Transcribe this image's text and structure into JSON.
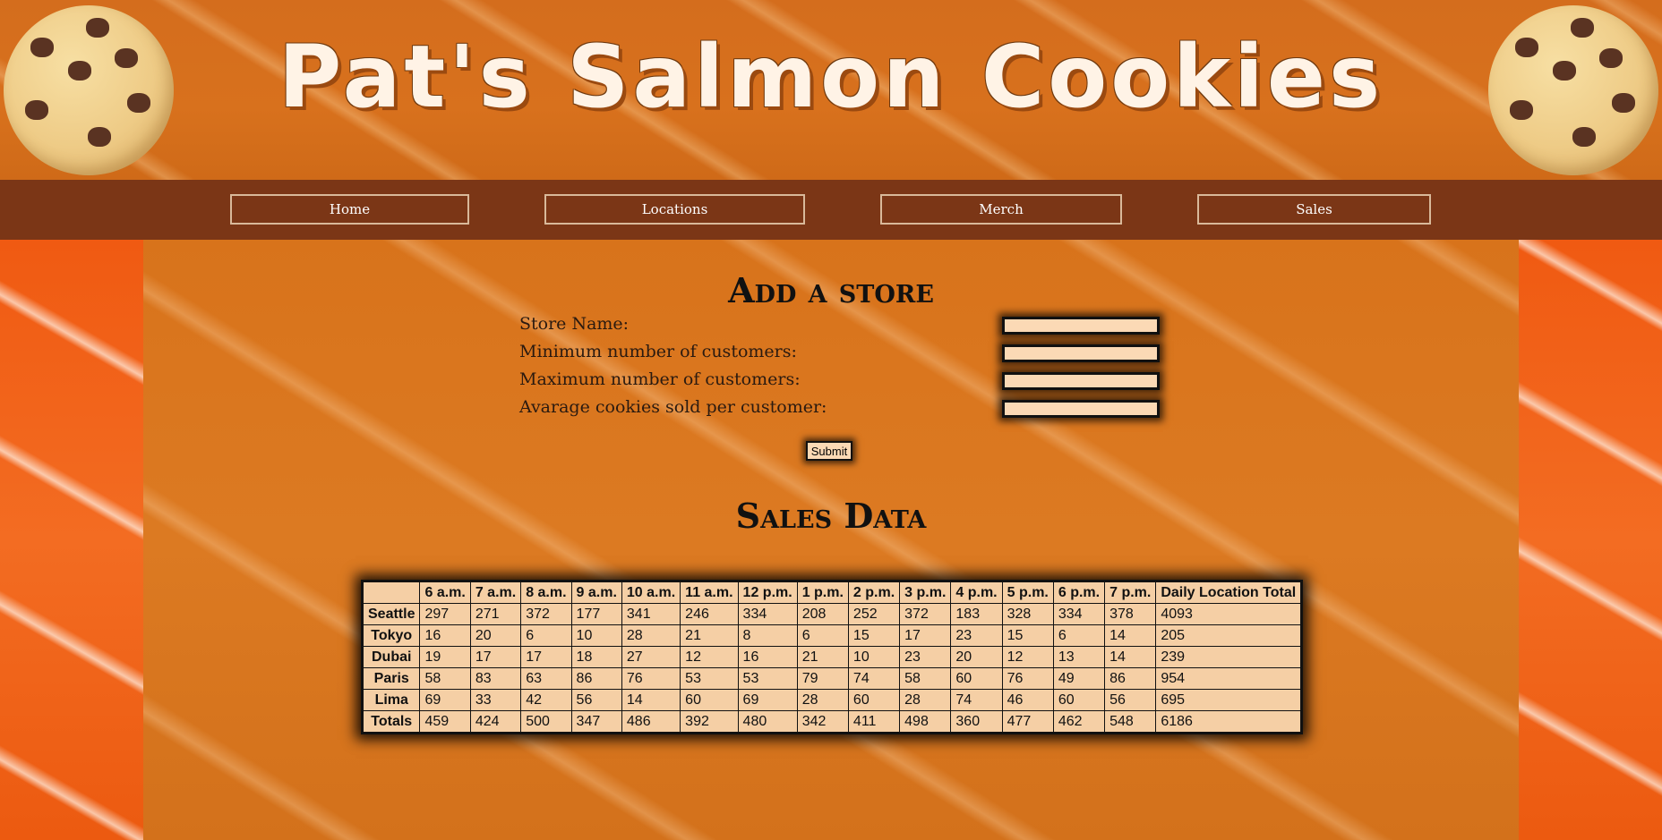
{
  "site": {
    "title": "Pat's Salmon Cookies"
  },
  "icons": {
    "left_cookie": "cookie-icon",
    "right_cookie": "cookie-icon"
  },
  "nav": {
    "items": [
      {
        "label": "Home"
      },
      {
        "label": "Locations"
      },
      {
        "label": "Merch"
      },
      {
        "label": "Sales"
      }
    ]
  },
  "form": {
    "heading": "Add a store",
    "fields": [
      {
        "label": "Store Name:",
        "value": ""
      },
      {
        "label": "Minimum number of customers:",
        "value": ""
      },
      {
        "label": "Maximum number of customers:",
        "value": ""
      },
      {
        "label": "Avarage cookies sold per customer:",
        "value": ""
      }
    ],
    "submit_label": "Submit"
  },
  "sales": {
    "heading": "Sales Data",
    "headers": [
      "",
      "6 a.m.",
      "7 a.m.",
      "8 a.m.",
      "9 a.m.",
      "10 a.m.",
      "11 a.m.",
      "12 p.m.",
      "1 p.m.",
      "2 p.m.",
      "3 p.m.",
      "4 p.m.",
      "5 p.m.",
      "6 p.m.",
      "7 p.m.",
      "Daily Location Total"
    ],
    "rows": [
      {
        "name": "Seattle",
        "values": [
          "297",
          "271",
          "372",
          "177",
          "341",
          "246",
          "334",
          "208",
          "252",
          "372",
          "183",
          "328",
          "334",
          "378",
          "4093"
        ]
      },
      {
        "name": "Tokyo",
        "values": [
          "16",
          "20",
          "6",
          "10",
          "28",
          "21",
          "8",
          "6",
          "15",
          "17",
          "23",
          "15",
          "6",
          "14",
          "205"
        ]
      },
      {
        "name": "Dubai",
        "values": [
          "19",
          "17",
          "17",
          "18",
          "27",
          "12",
          "16",
          "21",
          "10",
          "23",
          "20",
          "12",
          "13",
          "14",
          "239"
        ]
      },
      {
        "name": "Paris",
        "values": [
          "58",
          "83",
          "63",
          "86",
          "76",
          "53",
          "53",
          "79",
          "74",
          "58",
          "60",
          "76",
          "49",
          "86",
          "954"
        ]
      },
      {
        "name": "Lima",
        "values": [
          "69",
          "33",
          "42",
          "56",
          "14",
          "60",
          "69",
          "28",
          "60",
          "28",
          "74",
          "46",
          "60",
          "56",
          "695"
        ]
      },
      {
        "name": "Totals",
        "values": [
          "459",
          "424",
          "500",
          "347",
          "486",
          "392",
          "480",
          "342",
          "411",
          "498",
          "360",
          "477",
          "462",
          "548",
          "6186"
        ]
      }
    ]
  },
  "colors": {
    "nav_bg": "#7b3616",
    "nav_border": "#d9b99a",
    "table_bg": "#f5cfa5",
    "input_bg": "#fbd9b5"
  }
}
